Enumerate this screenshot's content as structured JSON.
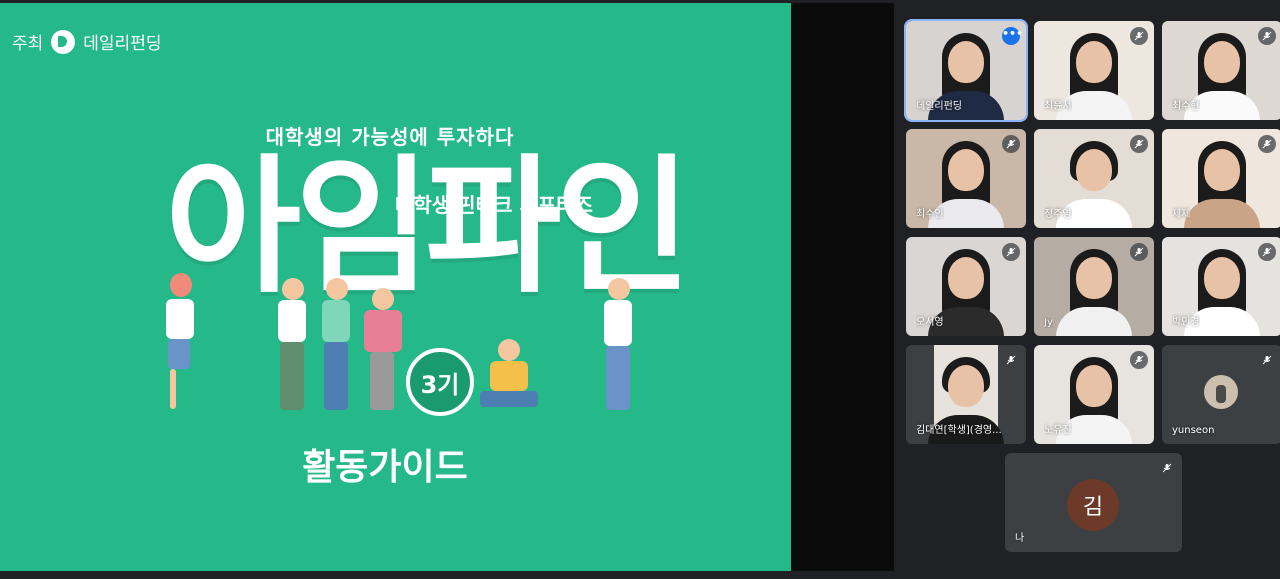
{
  "slide": {
    "organizer_label": "주최",
    "organizer_brand": "데일리펀딩",
    "tagline": "대학생의 가능성에 투자하다",
    "subtitle": "대학생 핀테크 서포터즈",
    "title": "아임파인",
    "season": "3기",
    "guide": "활동가이드",
    "colors": {
      "background": "#25b889",
      "badge": "#1a9a6f"
    }
  },
  "participants": [
    {
      "name": "데일리펀딩",
      "icon": "more-options-icon",
      "active": true
    },
    {
      "name": "최윤서",
      "icon": "mic-off-icon"
    },
    {
      "name": "최수현",
      "icon": "mic-off-icon"
    },
    {
      "name": "최수인",
      "icon": "mic-off-icon"
    },
    {
      "name": "정주영",
      "icon": "mic-off-icon"
    },
    {
      "name": "제제",
      "icon": "mic-off-icon"
    },
    {
      "name": "오서영",
      "icon": "mic-off-icon"
    },
    {
      "name": "Jy",
      "icon": "mic-off-icon"
    },
    {
      "name": "박민경",
      "icon": "mic-off-icon"
    },
    {
      "name": "김대연[학생](경영...",
      "icon": "mic-off-icon"
    },
    {
      "name": "노유진",
      "icon": "mic-off-icon"
    },
    {
      "name": "yunseon",
      "icon": "mic-off-icon"
    },
    {
      "name": "나",
      "initial": "김",
      "icon": "mic-off-icon"
    }
  ]
}
